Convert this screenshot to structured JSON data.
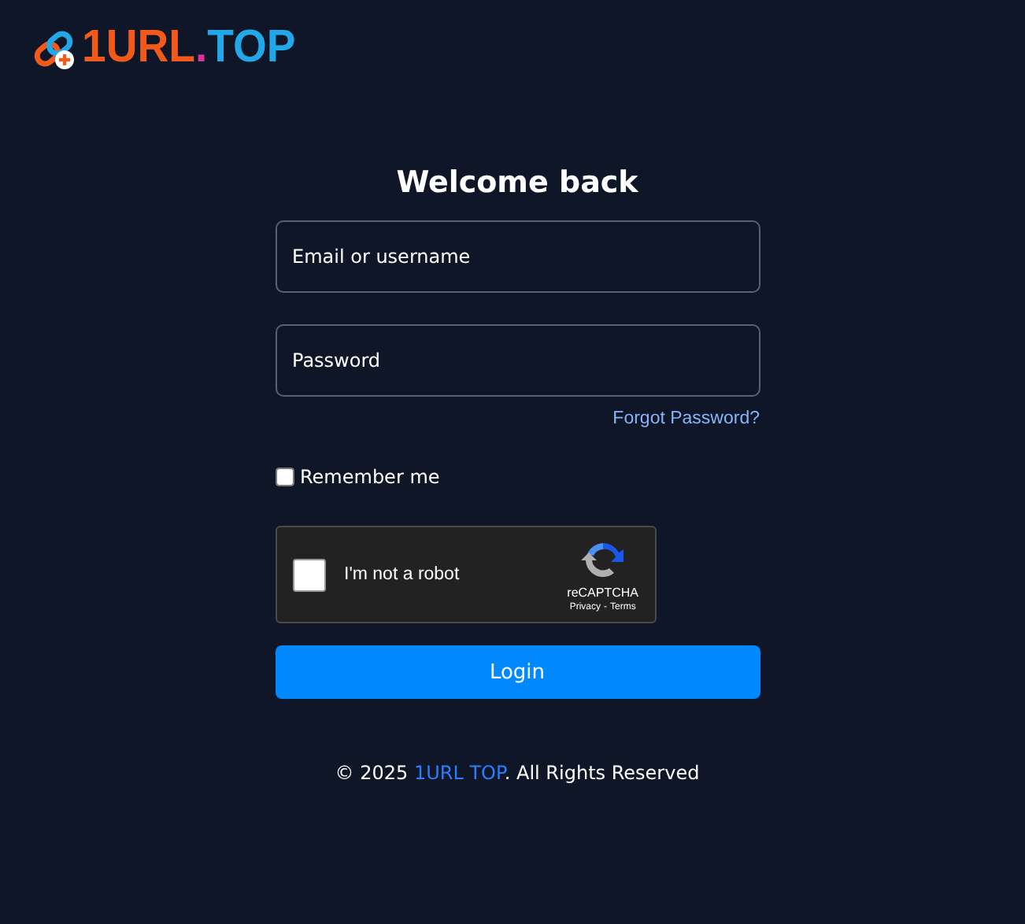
{
  "logo": {
    "parts": [
      {
        "text": "1URL",
        "color": "#f25a1c"
      },
      {
        "text": ".",
        "color": "#e0309a"
      },
      {
        "text": "TOP",
        "color": "#22a8e8"
      }
    ]
  },
  "title": "Welcome back",
  "fields": [
    {
      "placeholder": "Email or username"
    },
    {
      "placeholder": "Password"
    }
  ],
  "forgot_link": "Forgot Password?",
  "remember": {
    "label": "Remember me",
    "checked": false
  },
  "captcha": {
    "label": "I'm not a robot",
    "checked": false,
    "brand": "reCAPTCHA",
    "privacy": "Privacy",
    "separator": "-",
    "terms": "Terms"
  },
  "login_button": "Login",
  "footer": {
    "before": "© 2025 ",
    "link": "1URL TOP",
    "after": ". All Rights Reserved"
  }
}
